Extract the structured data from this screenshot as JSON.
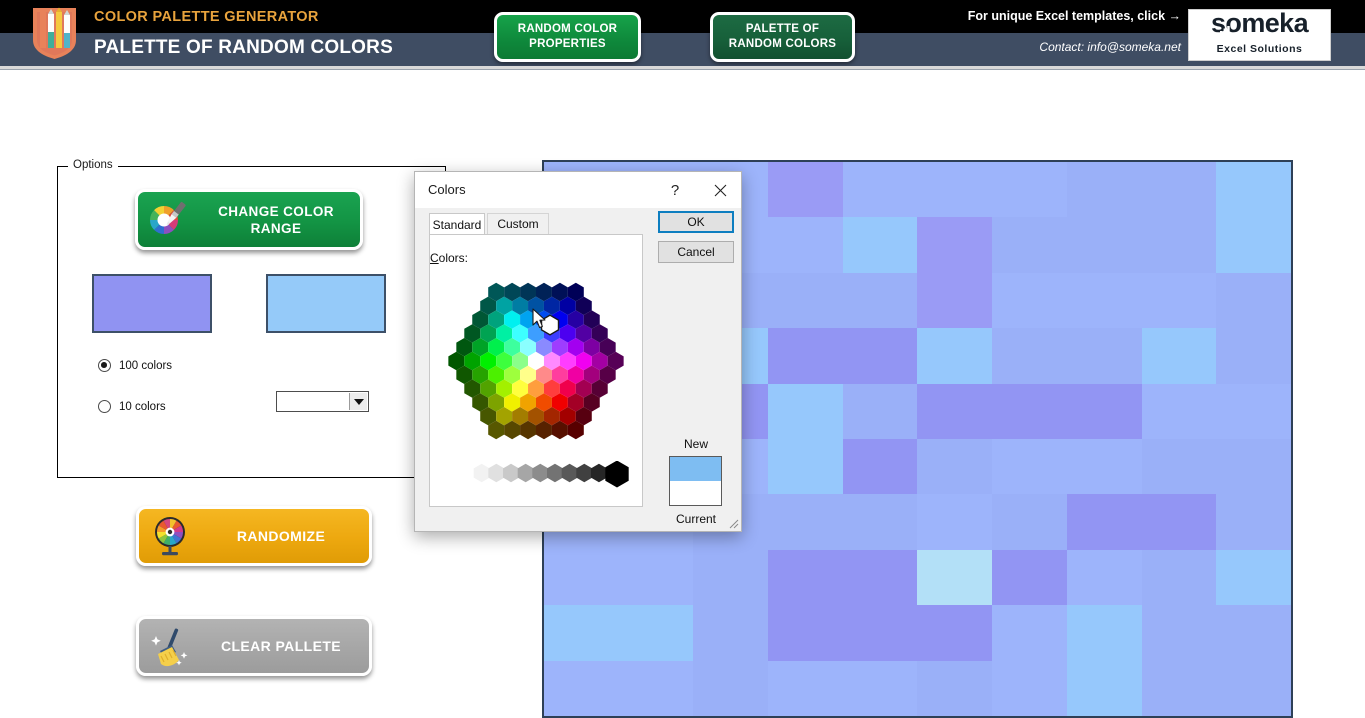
{
  "header": {
    "brand_title": "COLOR PALETTE GENERATOR",
    "brand_subtitle": "PALETTE OF RANDOM COLORS",
    "nav_buttons": [
      {
        "line1": "RANDOM COLOR",
        "line2": "PROPERTIES"
      },
      {
        "line1": "PALETTE OF",
        "line2": "RANDOM COLORS"
      }
    ],
    "promo_text": "For unique Excel templates, click →",
    "contact_text": "Contact: info@someka.net",
    "logo_word": "someka",
    "logo_tagline": "Excel Solutions",
    "brand_color": "#e8a33d",
    "bar_color": "#3f4d63"
  },
  "options": {
    "group_label": "Options",
    "change_range_button": {
      "line1": "CHANGE COLOR",
      "line2": "RANGE",
      "icon": "color-wheel-brush-icon"
    },
    "swatches": [
      {
        "name": "range-start-swatch",
        "color": "#9093f2"
      },
      {
        "name": "range-end-swatch",
        "color": "#95caf9"
      }
    ],
    "radios": [
      {
        "label": "100 colors",
        "selected": true
      },
      {
        "label": "10 colors",
        "selected": false
      }
    ],
    "dropdown_value": "",
    "randomize_button": {
      "label": "RANDOMIZE",
      "icon": "prize-wheel-icon",
      "color": "#edaa12"
    },
    "clear_button": {
      "label": "CLEAR PALLETE",
      "icon": "broom-sparkle-icon",
      "color": "#a6a6a6"
    }
  },
  "palette": {
    "border_color": "#2e4057",
    "rows": 10,
    "cols": 10,
    "cells": [
      [
        "#9db4fb",
        "#9db4fb",
        "#9db4fb",
        "#9a9bf5",
        "#9db4fb",
        "#9db4fb",
        "#9db4fb",
        "#9ab0f8",
        "#9ab0f8",
        "#96c8fc"
      ],
      [
        "#9db4fb",
        "#9db4fb",
        "#9db4fb",
        "#9db4fb",
        "#96c8fc",
        "#9a9bf5",
        "#9ab0f8",
        "#9ab0f8",
        "#9ab0f8",
        "#96c8fc"
      ],
      [
        "#9db4fb",
        "#9db4fb",
        "#9ab0f8",
        "#9ab0f8",
        "#9ab0f8",
        "#9a9bf5",
        "#9db4fb",
        "#9db4fb",
        "#9db4fb",
        "#9ab0f8"
      ],
      [
        "#9db4fb",
        "#9ab0f8",
        "#96c8fc",
        "#9295f3",
        "#9295f3",
        "#96c8fc",
        "#9ab0f8",
        "#9ab0f8",
        "#96c8fc",
        "#9ab0f8"
      ],
      [
        "#9db4fb",
        "#b3e0f7",
        "#9295f3",
        "#96c8fc",
        "#9ab0f8",
        "#9295f3",
        "#9295f3",
        "#9295f3",
        "#9db4fb",
        "#9db4fb"
      ],
      [
        "#9db4fb",
        "#9a9bf5",
        "#9db4fb",
        "#96c8fc",
        "#9295f3",
        "#9ab0f8",
        "#9db4fb",
        "#9db4fb",
        "#9ab0f8",
        "#9ab0f8"
      ],
      [
        "#9db4fb",
        "#9db4fb",
        "#9ab0f8",
        "#9ab0f8",
        "#9ab0f8",
        "#9db4fb",
        "#9ab0f8",
        "#9295f3",
        "#9295f3",
        "#9ab0f8"
      ],
      [
        "#9db4fb",
        "#9db4fb",
        "#9ab0f8",
        "#9295f3",
        "#9295f3",
        "#b3e0f7",
        "#9295f3",
        "#9db4fb",
        "#9ab0f8",
        "#96c8fc"
      ],
      [
        "#96c8fc",
        "#96c8fc",
        "#9ab0f8",
        "#9295f3",
        "#9295f3",
        "#9295f3",
        "#9db4fb",
        "#96c8fc",
        "#9ab0f8",
        "#9ab0f8"
      ],
      [
        "#9db4fb",
        "#9db4fb",
        "#9ab0f8",
        "#9db4fb",
        "#9db4fb",
        "#9ab0f8",
        "#9db4fb",
        "#96c8fc",
        "#9ab0f8",
        "#9ab0f8"
      ]
    ]
  },
  "dialog": {
    "title": "Colors",
    "help_glyph": "?",
    "close_glyph": "✕",
    "tabs": [
      {
        "label": "Standard",
        "selected": true
      },
      {
        "label": "Custom",
        "selected": false
      }
    ],
    "colors_label_prefix": "C",
    "colors_label_rest": "olors:",
    "ok_label": "OK",
    "cancel_label": "Cancel",
    "new_label": "New",
    "current_label": "Current",
    "new_color": "#7ebdf2",
    "current_color": "#ffffff",
    "ok_focus_color": "#0d7ec0"
  }
}
